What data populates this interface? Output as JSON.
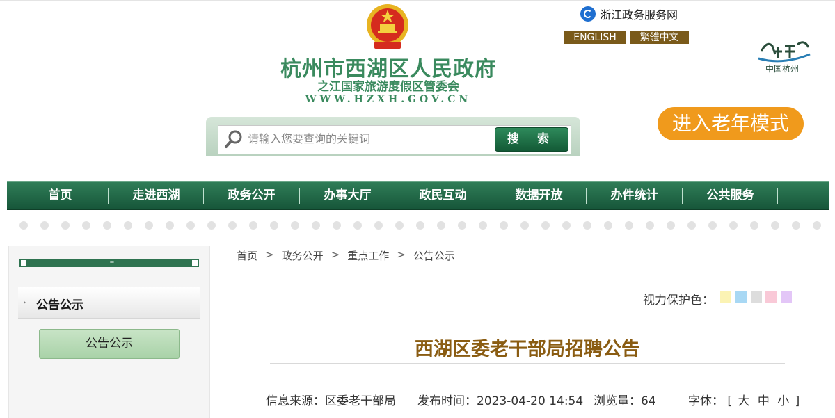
{
  "header": {
    "site_name": "杭州市西湖区人民政府",
    "site_subtitle": "之江国家旅游度假区管委会",
    "site_url": "WWW.HZXH.GOV.CN",
    "zj_service_link": "浙江政务服务网",
    "lang_english": "ENGLISH",
    "lang_traditional": "繁體中文",
    "hangzhou_logo_text": "中国杭州"
  },
  "search": {
    "placeholder": "请输入您要查询的关键词",
    "button_label": "搜 索"
  },
  "elder_mode_label": "进入老年模式",
  "nav": {
    "items": [
      "首页",
      "走进西湖",
      "政务公开",
      "办事大厅",
      "政民互动",
      "数据开放",
      "办件统计",
      "公共服务"
    ]
  },
  "sidebar": {
    "title": "公告公示",
    "button_label": "公告公示"
  },
  "breadcrumb": {
    "items": [
      "首页",
      "政务公开",
      "重点工作",
      "公告公示"
    ],
    "separator": ">"
  },
  "eye_protection": {
    "label": "视力保护色：",
    "colors": [
      "#fbf3b4",
      "#a8d8f4",
      "#dddddd",
      "#f9c9d7",
      "#e3c6f7"
    ]
  },
  "article": {
    "title": "西湖区委老干部局招聘公告",
    "source_label": "信息来源：",
    "source_value": "区委老干部局",
    "published_label": "发布时间：",
    "published_value": "2023-04-20 14:54",
    "views_label": "浏览量：",
    "views_value": "64",
    "font_label": "字体：",
    "font_open": "[",
    "font_large": "大",
    "font_medium": "中",
    "font_small": "小",
    "font_close": "]"
  },
  "colors": {
    "brand_green": "#2f7d57",
    "title_gold": "#8a5c12",
    "elder_orange": "#f09a1c"
  }
}
